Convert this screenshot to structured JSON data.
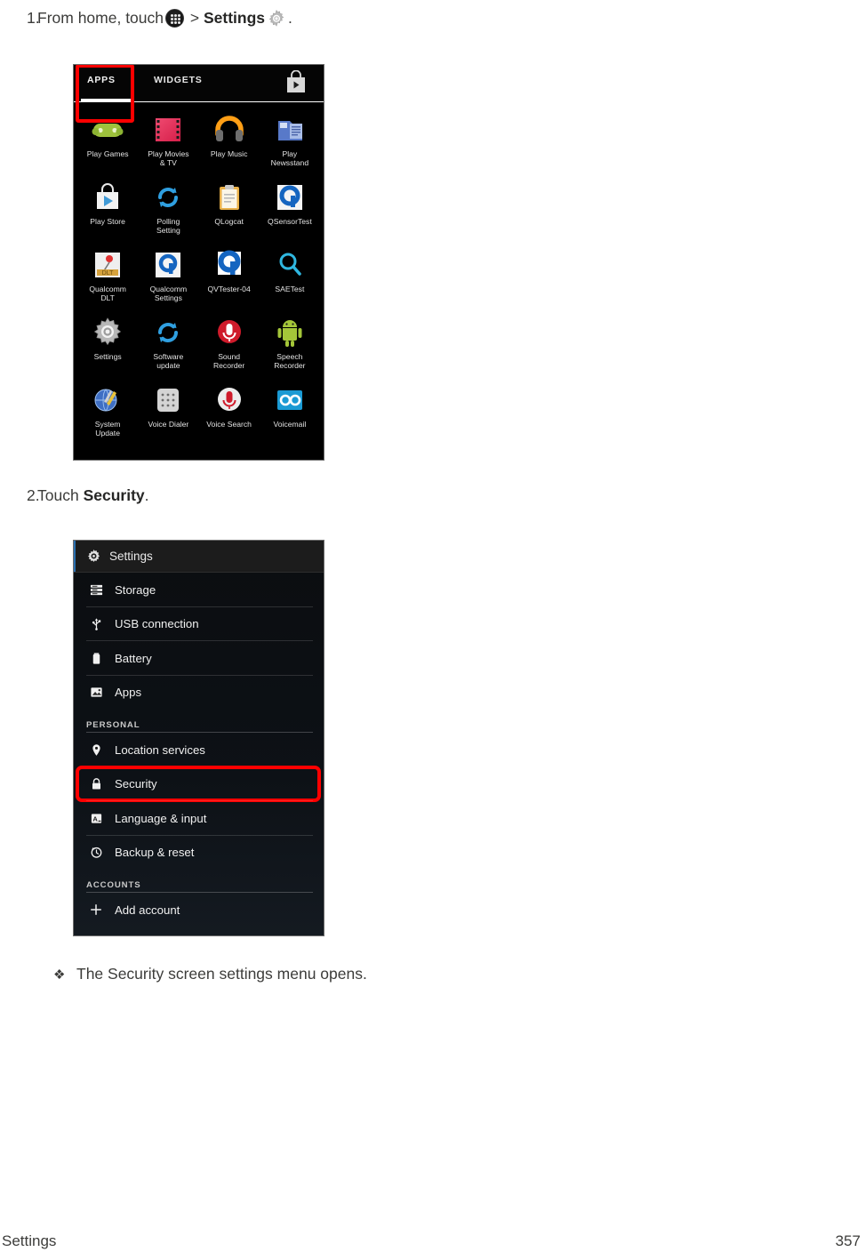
{
  "document": {
    "footer_section": "Settings",
    "page_number": "357"
  },
  "steps": [
    {
      "number": "1.",
      "text_before": "From home, touch",
      "icon_apps": "apps-grid-icon",
      "separator": ">",
      "bold_label": "Settings",
      "icon_gear": "gear-icon",
      "text_after": "."
    },
    {
      "number": "2.",
      "text_before": "Touch",
      "bold_label": "Security",
      "text_after": "."
    }
  ],
  "bullet": {
    "marker": "❖",
    "text": "The Security screen settings menu opens."
  },
  "apps_drawer": {
    "tabs": [
      {
        "label": "APPS",
        "selected": true
      },
      {
        "label": "WIDGETS",
        "selected": false
      }
    ],
    "store_icon": "play-store-bag-icon",
    "highlighted_app": "Settings",
    "highlight_color": "#ff0000",
    "rows": [
      [
        {
          "label": "Play Games",
          "icon": "gamepad-icon"
        },
        {
          "label": "Play Movies\n& TV",
          "icon": "film-strip-icon"
        },
        {
          "label": "Play Music",
          "icon": "headphones-icon"
        },
        {
          "label": "Play\nNewsstand",
          "icon": "newsstand-icon"
        }
      ],
      [
        {
          "label": "Play Store",
          "icon": "play-store-bag-icon"
        },
        {
          "label": "Polling\nSetting",
          "icon": "refresh-arrows-icon"
        },
        {
          "label": "QLogcat",
          "icon": "clipboard-icon"
        },
        {
          "label": "QSensorTest",
          "icon": "qualcomm-q-icon"
        }
      ],
      [
        {
          "label": "Qualcomm\nDLT",
          "icon": "qualcomm-dlt-icon"
        },
        {
          "label": "Qualcomm\nSettings",
          "icon": "qualcomm-q-icon"
        },
        {
          "label": "QVTester-04",
          "icon": "qualcomm-q-icon"
        },
        {
          "label": "SAETest",
          "icon": "magnifier-icon"
        }
      ],
      [
        {
          "label": "Settings",
          "icon": "gear-icon"
        },
        {
          "label": "Software\nupdate",
          "icon": "refresh-arrows-icon"
        },
        {
          "label": "Sound\nRecorder",
          "icon": "red-mic-icon"
        },
        {
          "label": "Speech\nRecorder",
          "icon": "android-robot-icon"
        }
      ],
      [
        {
          "label": "System\nUpdate",
          "icon": "tools-globe-icon"
        },
        {
          "label": "Voice Dialer",
          "icon": "keypad-icon"
        },
        {
          "label": "Voice Search",
          "icon": "white-mic-icon"
        },
        {
          "label": "Voicemail",
          "icon": "voicemail-tape-icon"
        }
      ]
    ]
  },
  "settings_screen": {
    "title": "Settings",
    "title_icon": "gear-icon",
    "highlighted_item": "Security",
    "highlight_color": "#ff0000",
    "items": [
      {
        "type": "row",
        "label": "Storage",
        "icon": "storage-stack-icon"
      },
      {
        "type": "row",
        "label": "USB connection",
        "icon": "usb-icon"
      },
      {
        "type": "row",
        "label": "Battery",
        "icon": "battery-icon"
      },
      {
        "type": "row",
        "label": "Apps",
        "icon": "apps-image-icon"
      },
      {
        "type": "header",
        "label": "PERSONAL"
      },
      {
        "type": "row",
        "label": "Location services",
        "icon": "location-pin-icon"
      },
      {
        "type": "row",
        "label": "Security",
        "icon": "lock-icon",
        "highlighted": true
      },
      {
        "type": "row",
        "label": "Language & input",
        "icon": "language-a-icon"
      },
      {
        "type": "row",
        "label": "Backup & reset",
        "icon": "backup-clock-icon"
      },
      {
        "type": "header",
        "label": "ACCOUNTS"
      },
      {
        "type": "row",
        "label": "Add account",
        "icon": "plus-icon"
      }
    ]
  }
}
